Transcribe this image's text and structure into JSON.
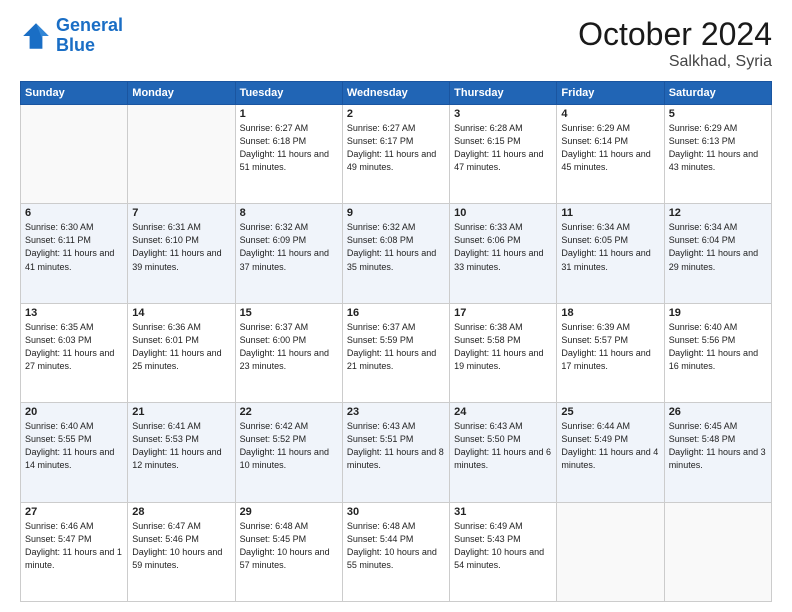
{
  "header": {
    "logo_general": "General",
    "logo_blue": "Blue",
    "month": "October 2024",
    "location": "Salkhad, Syria"
  },
  "days_of_week": [
    "Sunday",
    "Monday",
    "Tuesday",
    "Wednesday",
    "Thursday",
    "Friday",
    "Saturday"
  ],
  "weeks": [
    [
      {
        "day": "",
        "info": ""
      },
      {
        "day": "",
        "info": ""
      },
      {
        "day": "1",
        "info": "Sunrise: 6:27 AM\nSunset: 6:18 PM\nDaylight: 11 hours and 51 minutes."
      },
      {
        "day": "2",
        "info": "Sunrise: 6:27 AM\nSunset: 6:17 PM\nDaylight: 11 hours and 49 minutes."
      },
      {
        "day": "3",
        "info": "Sunrise: 6:28 AM\nSunset: 6:15 PM\nDaylight: 11 hours and 47 minutes."
      },
      {
        "day": "4",
        "info": "Sunrise: 6:29 AM\nSunset: 6:14 PM\nDaylight: 11 hours and 45 minutes."
      },
      {
        "day": "5",
        "info": "Sunrise: 6:29 AM\nSunset: 6:13 PM\nDaylight: 11 hours and 43 minutes."
      }
    ],
    [
      {
        "day": "6",
        "info": "Sunrise: 6:30 AM\nSunset: 6:11 PM\nDaylight: 11 hours and 41 minutes."
      },
      {
        "day": "7",
        "info": "Sunrise: 6:31 AM\nSunset: 6:10 PM\nDaylight: 11 hours and 39 minutes."
      },
      {
        "day": "8",
        "info": "Sunrise: 6:32 AM\nSunset: 6:09 PM\nDaylight: 11 hours and 37 minutes."
      },
      {
        "day": "9",
        "info": "Sunrise: 6:32 AM\nSunset: 6:08 PM\nDaylight: 11 hours and 35 minutes."
      },
      {
        "day": "10",
        "info": "Sunrise: 6:33 AM\nSunset: 6:06 PM\nDaylight: 11 hours and 33 minutes."
      },
      {
        "day": "11",
        "info": "Sunrise: 6:34 AM\nSunset: 6:05 PM\nDaylight: 11 hours and 31 minutes."
      },
      {
        "day": "12",
        "info": "Sunrise: 6:34 AM\nSunset: 6:04 PM\nDaylight: 11 hours and 29 minutes."
      }
    ],
    [
      {
        "day": "13",
        "info": "Sunrise: 6:35 AM\nSunset: 6:03 PM\nDaylight: 11 hours and 27 minutes."
      },
      {
        "day": "14",
        "info": "Sunrise: 6:36 AM\nSunset: 6:01 PM\nDaylight: 11 hours and 25 minutes."
      },
      {
        "day": "15",
        "info": "Sunrise: 6:37 AM\nSunset: 6:00 PM\nDaylight: 11 hours and 23 minutes."
      },
      {
        "day": "16",
        "info": "Sunrise: 6:37 AM\nSunset: 5:59 PM\nDaylight: 11 hours and 21 minutes."
      },
      {
        "day": "17",
        "info": "Sunrise: 6:38 AM\nSunset: 5:58 PM\nDaylight: 11 hours and 19 minutes."
      },
      {
        "day": "18",
        "info": "Sunrise: 6:39 AM\nSunset: 5:57 PM\nDaylight: 11 hours and 17 minutes."
      },
      {
        "day": "19",
        "info": "Sunrise: 6:40 AM\nSunset: 5:56 PM\nDaylight: 11 hours and 16 minutes."
      }
    ],
    [
      {
        "day": "20",
        "info": "Sunrise: 6:40 AM\nSunset: 5:55 PM\nDaylight: 11 hours and 14 minutes."
      },
      {
        "day": "21",
        "info": "Sunrise: 6:41 AM\nSunset: 5:53 PM\nDaylight: 11 hours and 12 minutes."
      },
      {
        "day": "22",
        "info": "Sunrise: 6:42 AM\nSunset: 5:52 PM\nDaylight: 11 hours and 10 minutes."
      },
      {
        "day": "23",
        "info": "Sunrise: 6:43 AM\nSunset: 5:51 PM\nDaylight: 11 hours and 8 minutes."
      },
      {
        "day": "24",
        "info": "Sunrise: 6:43 AM\nSunset: 5:50 PM\nDaylight: 11 hours and 6 minutes."
      },
      {
        "day": "25",
        "info": "Sunrise: 6:44 AM\nSunset: 5:49 PM\nDaylight: 11 hours and 4 minutes."
      },
      {
        "day": "26",
        "info": "Sunrise: 6:45 AM\nSunset: 5:48 PM\nDaylight: 11 hours and 3 minutes."
      }
    ],
    [
      {
        "day": "27",
        "info": "Sunrise: 6:46 AM\nSunset: 5:47 PM\nDaylight: 11 hours and 1 minute."
      },
      {
        "day": "28",
        "info": "Sunrise: 6:47 AM\nSunset: 5:46 PM\nDaylight: 10 hours and 59 minutes."
      },
      {
        "day": "29",
        "info": "Sunrise: 6:48 AM\nSunset: 5:45 PM\nDaylight: 10 hours and 57 minutes."
      },
      {
        "day": "30",
        "info": "Sunrise: 6:48 AM\nSunset: 5:44 PM\nDaylight: 10 hours and 55 minutes."
      },
      {
        "day": "31",
        "info": "Sunrise: 6:49 AM\nSunset: 5:43 PM\nDaylight: 10 hours and 54 minutes."
      },
      {
        "day": "",
        "info": ""
      },
      {
        "day": "",
        "info": ""
      }
    ]
  ]
}
